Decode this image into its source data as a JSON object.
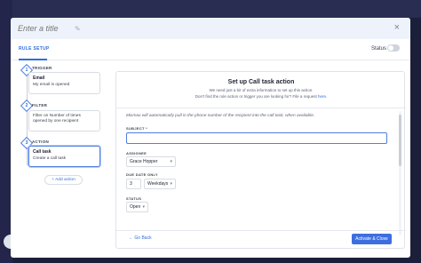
{
  "modal": {
    "title_placeholder": "Enter a title",
    "close_icon": "×",
    "pencil_icon": "✎"
  },
  "tabs": {
    "rule_setup": "RULE SETUP"
  },
  "status": {
    "label": "Status",
    "on": false
  },
  "steps": [
    {
      "num": "1",
      "label": "TRIGGER",
      "title": "Email",
      "desc": "My email is opened"
    },
    {
      "num": "2",
      "label": "FILTER",
      "title": "Filter on Number of times opened by one recipient",
      "desc": ""
    },
    {
      "num": "3",
      "label": "ACTION",
      "title": "Call task",
      "desc": "Create a call task"
    }
  ],
  "add_action": "+ Add action",
  "panel": {
    "title": "Set up Call task action",
    "desc": "We need just a bit of extra information to set up this action.",
    "desc2": "Don't find the rule action or trigger you are looking for? File a request",
    "desc_link": "here.",
    "note": "Mixmax will automatically pull in the phone number of the recipient into the call task, when available.",
    "subject_label": "SUBJECT *",
    "subject_value": "",
    "assignee_label": "ASSIGNEE",
    "assignee_value": "Grace Hopper",
    "due_label": "DUE DATE ONLY",
    "due_num": "3",
    "due_unit": "Weekdays",
    "status_label": "STATUS",
    "status_value": "Open",
    "back": "← Go Back",
    "activate": "Activate & Close"
  },
  "colors": {
    "accent": "#2f6dde",
    "button": "#3c6ee0",
    "header": "#eef3fb"
  }
}
